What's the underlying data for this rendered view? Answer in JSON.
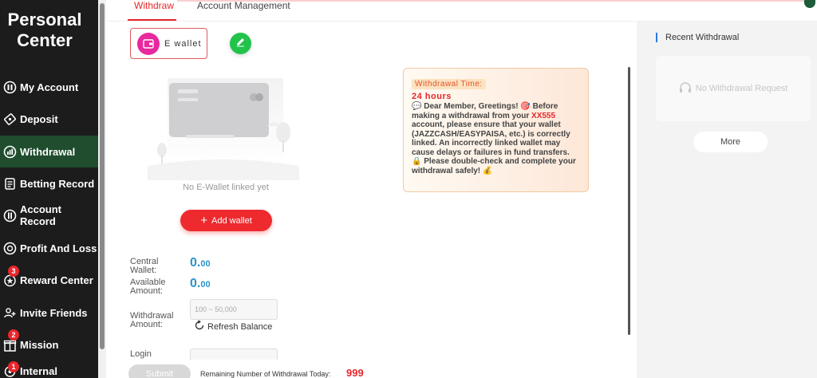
{
  "sidebar": {
    "title_line1": "Personal",
    "title_line2": "Center",
    "items": [
      {
        "label": "My Account",
        "icon": "account-icon"
      },
      {
        "label": "Deposit",
        "icon": "deposit-icon"
      },
      {
        "label": "Withdrawal",
        "icon": "withdrawal-icon",
        "active": true
      },
      {
        "label": "Betting Record",
        "icon": "betting-record-icon"
      },
      {
        "label": "Account Record",
        "icon": "account-record-icon"
      },
      {
        "label": "Profit And Loss",
        "icon": "profit-loss-icon"
      },
      {
        "label": "Reward Center",
        "icon": "reward-icon",
        "badge": "3"
      },
      {
        "label": "Invite Friends",
        "icon": "invite-icon"
      },
      {
        "label": "Mission",
        "icon": "mission-icon",
        "badge": "2"
      },
      {
        "label": "Internal",
        "icon": "internal-icon",
        "badge": "1"
      }
    ]
  },
  "tabs": [
    {
      "label": "Withdraw",
      "active": true
    },
    {
      "label": "Account Management",
      "active": false
    }
  ],
  "wallet": {
    "chip_label": "E wallet",
    "empty_text": "No E-Wallet linked yet",
    "add_button": "Add wallet"
  },
  "form": {
    "central_wallet_label_1": "Central",
    "central_wallet_label_2": "Wallet:",
    "central_wallet_int": "0.",
    "central_wallet_dec": "00",
    "available_label_1": "Available",
    "available_label_2": "Amount:",
    "available_int": "0.",
    "available_dec": "00",
    "withdrawal_label_1": "Withdrawal",
    "withdrawal_label_2": "Amount:",
    "withdrawal_placeholder": "100 ~ 50,000",
    "refresh_label": "Refresh Balance",
    "login_label": "Login",
    "submit_label": "Submit",
    "remaining_label": "Remaining Number of Withdrawal Today:",
    "remaining_count": "999"
  },
  "notice": {
    "title": "Withdrawal Time:",
    "hours": "24 hours",
    "line_intro_1": "💬 Dear Member, Greetings! 🎯 Before making a withdrawal from your ",
    "brand": "XX555",
    "line_intro_2": " account, please ensure that your wallet (JAZZCASH/EASYPAISA, etc.) is correctly linked. An incorrectly linked wallet may cause delays or failures in fund transfers.",
    "line_warn": "🔒 Please double-check and complete your withdrawal safely! 💰"
  },
  "right": {
    "recent_title": "Recent Withdrawal",
    "empty_text": "No Withdrawal Request",
    "more_label": "More"
  },
  "colors": {
    "accent_red": "#e8262b",
    "sidebar_bg": "#1c1c1c",
    "active_nav_bg": "#1f4d2e",
    "amount_blue": "#2a93c9",
    "edit_green": "#22c34a",
    "ewallet_pink": "#e8289d"
  }
}
